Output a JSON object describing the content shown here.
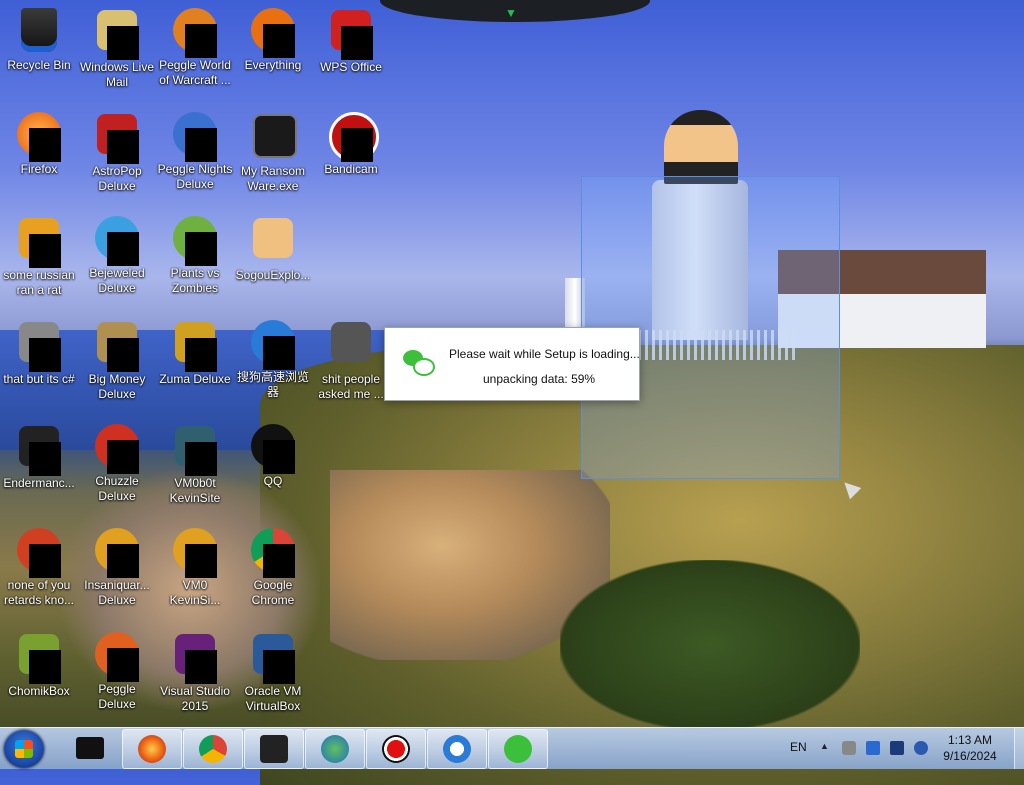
{
  "desktop": {
    "icons": [
      {
        "label": "Recycle Bin"
      },
      {
        "label": "Windows Live Mail"
      },
      {
        "label": "Peggle World of Warcraft ..."
      },
      {
        "label": "Everything"
      },
      {
        "label": "WPS Office"
      },
      {
        "label": "Firefox"
      },
      {
        "label": "AstroPop Deluxe"
      },
      {
        "label": "Peggle Nights Deluxe"
      },
      {
        "label": "My Ransom Ware.exe"
      },
      {
        "label": "Bandicam"
      },
      {
        "label": "some russian ran a rat"
      },
      {
        "label": "Bejeweled Deluxe"
      },
      {
        "label": "Plants vs Zombies"
      },
      {
        "label": "SogouExplo..."
      },
      {
        "label": "that but its c#"
      },
      {
        "label": "Big Money Deluxe"
      },
      {
        "label": "Zuma Deluxe"
      },
      {
        "label": "搜狗高速浏览器"
      },
      {
        "label": "shit people asked me ..."
      },
      {
        "label": "Endermanc..."
      },
      {
        "label": "Chuzzle Deluxe"
      },
      {
        "label": "VM0b0t KevinSite"
      },
      {
        "label": "QQ"
      },
      {
        "label": "none of you retards kno..."
      },
      {
        "label": "Insaniquar... Deluxe"
      },
      {
        "label": "VM0 KevinSi..."
      },
      {
        "label": "Google Chrome"
      },
      {
        "label": "ChomikBox"
      },
      {
        "label": "Peggle Deluxe"
      },
      {
        "label": "Visual Studio 2015"
      },
      {
        "label": "Oracle VM VirtualBox"
      }
    ]
  },
  "setup_dialog": {
    "message": "Please wait while Setup is loading...",
    "progress_text": "unpacking data: 59%",
    "progress_percent": 59
  },
  "taskbar": {
    "language": "EN",
    "time": "1:13 AM",
    "date": "9/16/2024",
    "pinned": [
      "firefox",
      "chrome",
      "terminal",
      "internet-download-manager",
      "bandicam",
      "sogou",
      "wechat"
    ]
  },
  "colors": {
    "wechat_green": "#3cc03c",
    "selection_blue": "#5b8fe0"
  }
}
